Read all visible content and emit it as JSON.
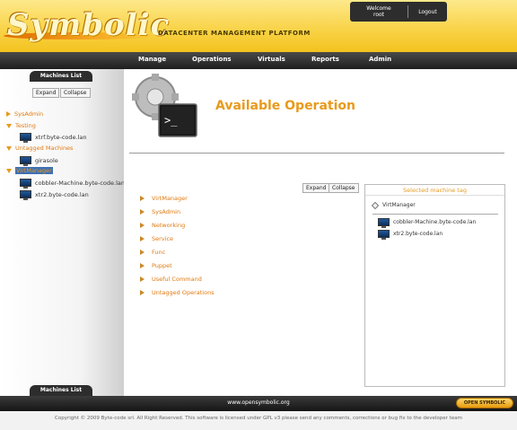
{
  "header": {
    "logo_text": "Symbolic",
    "tagline": "DATACENTER MANAGEMENT PLATFORM",
    "welcome_line1": "Welcome",
    "welcome_line2": "root",
    "logout_label": "Logout"
  },
  "nav": {
    "items": [
      "Manage",
      "Operations",
      "Virtuals",
      "Reports",
      "Admin"
    ]
  },
  "sidebar": {
    "top_tab": "Machines List",
    "bottom_tab": "Machines List",
    "expand_label": "Expand",
    "collapse_label": "Collapse",
    "groups": [
      {
        "label": "SysAdmin",
        "expanded": false
      },
      {
        "label": "Testing",
        "expanded": true,
        "machines": [
          "xtrf.byte-code.lan"
        ]
      },
      {
        "label": "Untagged Machines",
        "expanded": true,
        "machines": [
          "girasole"
        ]
      },
      {
        "label": "VirtManager",
        "expanded": true,
        "machines": [
          "cobbler-Machine.byte-code.lan",
          "xtr2.byte-code.lan"
        ]
      }
    ]
  },
  "main": {
    "title": "Available Operation",
    "expand_label": "Expand",
    "collapse_label": "Collapse",
    "operations": [
      "VirtManager",
      "SysAdmin",
      "Networking",
      "Service",
      "Func",
      "Puppet",
      "Useful Command",
      "Untagged Operations"
    ],
    "panel": {
      "title": "Selected machine tag",
      "tag": "VirtManager",
      "machines": [
        "cobbler-Machine.byte-code.lan",
        "xtr2.byte-code.lan"
      ]
    }
  },
  "footer": {
    "url": "www.opensymbolic.org",
    "badge": "OPEN SYMBOLIC",
    "copyright": "Copyright © 2009 Byte-code srl. All Right Reserved. This software is licensed under GPL v3 please send any comments, corrections or bug fix to the developer team"
  },
  "colors": {
    "accent": "#e89a1c",
    "header_yellow": "#f9d44a",
    "nav_dark": "#2d2d2d",
    "selected_group_bg": "#3f6fb2"
  }
}
